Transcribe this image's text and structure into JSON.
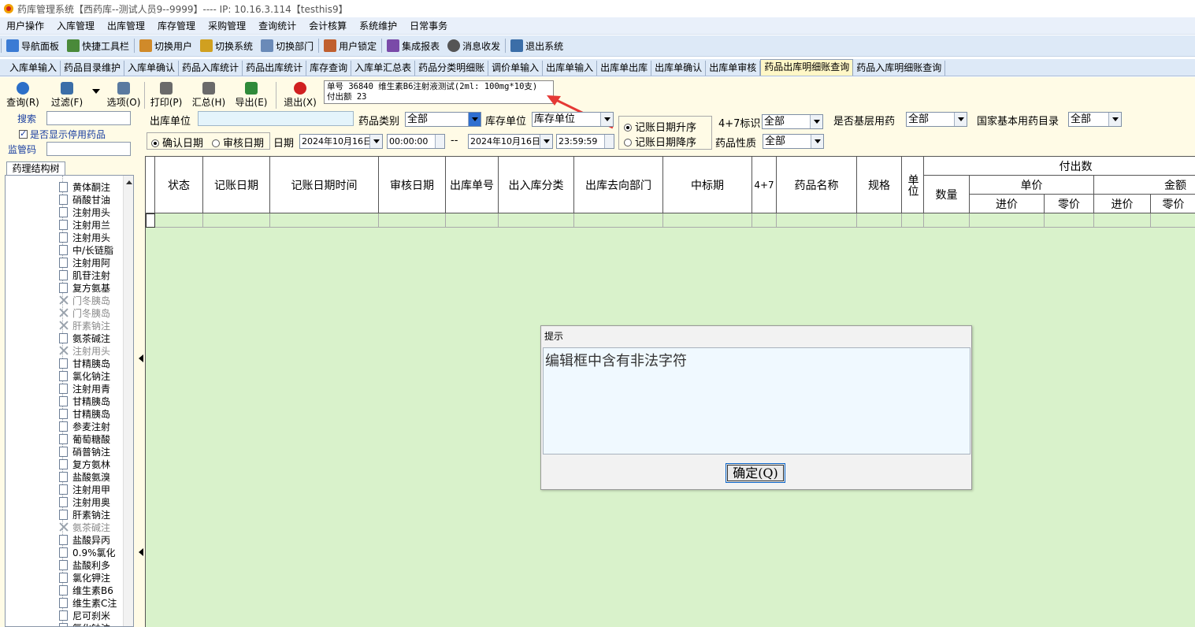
{
  "window": {
    "title": "药库管理系统【西药库--测试人员9--9999】---- IP:  10.16.3.114【testhis9】"
  },
  "menu": [
    "用户操作",
    "入库管理",
    "出库管理",
    "库存管理",
    "采购管理",
    "查询统计",
    "会计核算",
    "系统维护",
    "日常事务"
  ],
  "toolbar": [
    {
      "label": "导航面板",
      "icon": "navigation-panel-icon",
      "color": "#3b7bd4"
    },
    {
      "label": "快捷工具栏",
      "icon": "quick-toolbar-icon",
      "color": "#4a8a3a"
    },
    {
      "label": "切换用户",
      "icon": "switch-user-icon",
      "color": "#d08a2a"
    },
    {
      "label": "切换系统",
      "icon": "switch-system-icon",
      "color": "#d0a020"
    },
    {
      "label": "切换部门",
      "icon": "switch-department-icon",
      "color": "#6a8ab8"
    },
    {
      "label": "用户锁定",
      "icon": "user-lock-icon",
      "color": "#c06030"
    },
    {
      "label": "集成报表",
      "icon": "integrated-report-icon",
      "color": "#7a4aa8"
    },
    {
      "label": "消息收发",
      "icon": "message-icon",
      "color": "#555555"
    },
    {
      "label": "退出系统",
      "icon": "exit-system-icon",
      "color": "#3b6ea8"
    }
  ],
  "tabs": [
    {
      "label": "入库单输入"
    },
    {
      "label": "药品目录维护"
    },
    {
      "label": "入库单确认"
    },
    {
      "label": "药品入库统计"
    },
    {
      "label": "药品出库统计"
    },
    {
      "label": "库存查询"
    },
    {
      "label": "入库单汇总表"
    },
    {
      "label": "药品分类明细账"
    },
    {
      "label": "调价单输入"
    },
    {
      "label": "出库单输入"
    },
    {
      "label": "出库单出库"
    },
    {
      "label": "出库单确认"
    },
    {
      "label": "出库单审核"
    },
    {
      "label": "药品出库明细账查询",
      "active": true
    },
    {
      "label": "药品入库明细账查询"
    }
  ],
  "actions": [
    {
      "label": "查询(R)",
      "icon": "query-icon",
      "color": "#2b6fc8"
    },
    {
      "label": "过滤(F)",
      "icon": "filter-icon",
      "color": "#3b6ea8"
    },
    {
      "label": "选项(O)",
      "icon": "options-icon",
      "color": "#5a7aa0"
    },
    {
      "label": "打印(P)",
      "icon": "print-icon",
      "color": "#6a6a6a"
    },
    {
      "label": "汇总(H)",
      "icon": "summary-icon",
      "color": "#6a6a6a"
    },
    {
      "label": "导出(E)",
      "icon": "excel-export-icon",
      "color": "#2f8a3a"
    },
    {
      "label": "退出(X)",
      "icon": "exit-icon",
      "color": "#d02020"
    }
  ],
  "info": {
    "line1": "单号 36840  维生素B6注射液测试(2ml: 100mg*10支)",
    "line2": "付出额 23"
  },
  "left": {
    "search_label": "搜索",
    "show_disabled_label": "是否显示停用药品",
    "show_disabled_checked": true,
    "regulatory_code_label": "监管码",
    "tree_tab": "药理结构树",
    "tree_items": [
      {
        "text": "黄体酮注",
        "disabled": false
      },
      {
        "text": "硝酸甘油",
        "disabled": false
      },
      {
        "text": "注射用头",
        "disabled": false
      },
      {
        "text": "注射用兰",
        "disabled": false
      },
      {
        "text": "注射用头",
        "disabled": false
      },
      {
        "text": "中/长链脂",
        "disabled": false
      },
      {
        "text": "注射用阿",
        "disabled": false
      },
      {
        "text": "肌苷注射",
        "disabled": false
      },
      {
        "text": "复方氨基",
        "disabled": false
      },
      {
        "text": "门冬胰岛",
        "disabled": true
      },
      {
        "text": "门冬胰岛",
        "disabled": true
      },
      {
        "text": "肝素钠注",
        "disabled": true
      },
      {
        "text": "氨茶碱注",
        "disabled": false
      },
      {
        "text": "注射用头",
        "disabled": true
      },
      {
        "text": "甘精胰岛",
        "disabled": false
      },
      {
        "text": "氯化钠注",
        "disabled": false
      },
      {
        "text": "注射用青",
        "disabled": false
      },
      {
        "text": "甘精胰岛",
        "disabled": false
      },
      {
        "text": "甘精胰岛",
        "disabled": false
      },
      {
        "text": "参麦注射",
        "disabled": false
      },
      {
        "text": "葡萄糖酸",
        "disabled": false
      },
      {
        "text": "硝普钠注",
        "disabled": false
      },
      {
        "text": "复方氨林",
        "disabled": false
      },
      {
        "text": "盐酸氨溴",
        "disabled": false
      },
      {
        "text": "注射用甲",
        "disabled": false
      },
      {
        "text": "注射用奥",
        "disabled": false
      },
      {
        "text": "肝素钠注",
        "disabled": false
      },
      {
        "text": "氨茶碱注",
        "disabled": true
      },
      {
        "text": "盐酸异丙",
        "disabled": false
      },
      {
        "text": "0.9%氯化",
        "disabled": false
      },
      {
        "text": "盐酸利多",
        "disabled": false
      },
      {
        "text": "氯化钾注",
        "disabled": false
      },
      {
        "text": "维生素B6",
        "disabled": false
      },
      {
        "text": "维生素C注",
        "disabled": false
      },
      {
        "text": "尼可刹米",
        "disabled": false
      },
      {
        "text": "氯化钠注",
        "disabled": false
      }
    ]
  },
  "filters": {
    "out_unit_label": "出库单位",
    "out_unit_value": "",
    "drug_category_label": "药品类别",
    "drug_category_value": "全部",
    "stock_unit_label": "库存单位",
    "stock_unit_value": "库存单位",
    "sort_asc_label": "记账日期升序",
    "sort_desc_label": "记账日期降序",
    "sort_selected": "asc",
    "tag47_label": "4+7标识",
    "tag47_value": "全部",
    "basic_drug_label": "是否基层用药",
    "basic_drug_value": "全部",
    "national_list_label": "国家基本用药目录",
    "national_list_value": "全部",
    "confirm_date_label": "确认日期",
    "audit_date_label": "审核日期",
    "date_type_selected": "confirm",
    "date_label": "日期",
    "date_from": "2024年10月16日",
    "time_from": "00:00:00",
    "range_sep": "--",
    "date_to": "2024年10月16日",
    "time_to": "23:59:59",
    "drug_nature_label": "药品性质",
    "drug_nature_value": "全部"
  },
  "grid": {
    "columns": [
      "状态",
      "记账日期",
      "记账日期时间",
      "审核日期",
      "出库单号",
      "出入库分类",
      "出库去向部门",
      "中标期",
      "4+7",
      "药品名称",
      "规格",
      "单位"
    ],
    "group_paid": "付出数",
    "qty": "数量",
    "unit_price": "单价",
    "amount": "金额",
    "purchase_price": "进价",
    "retail_price": "零价",
    "purchase_price2": "进价",
    "retail_price2": "零价"
  },
  "dialog": {
    "title": "提示",
    "message": "编辑框中含有非法字符",
    "ok_label": "确定(Q)"
  },
  "colors": {
    "grid_background": "#d9f2cb",
    "content_background": "#fffbe6",
    "active_tab": "#fff7c7",
    "annotation_arrow": "#e53935"
  }
}
